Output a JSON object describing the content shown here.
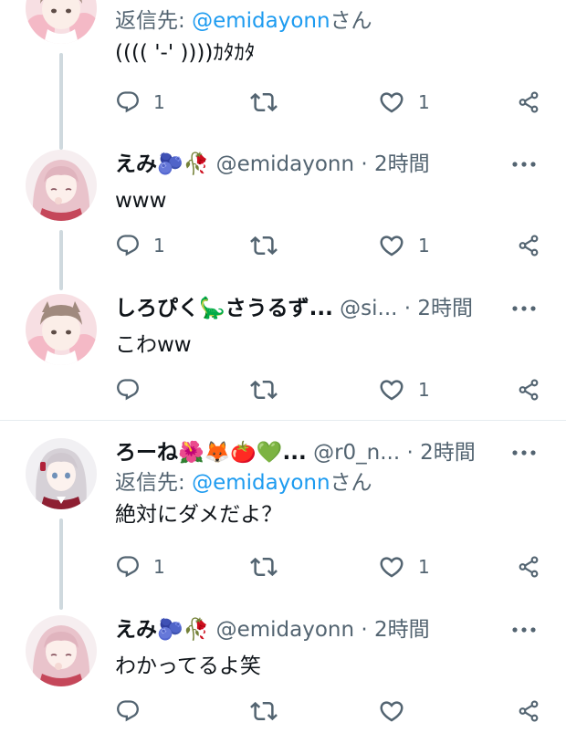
{
  "tweets": [
    {
      "name": "",
      "handle": "",
      "time": "",
      "reply_prefix": "返信先: ",
      "reply_mention": "@emidayonn",
      "reply_suffix": "さん",
      "text": "(((( '-'  ))))ｶﾀｶﾀ",
      "reply_count": "1",
      "like_count": "1",
      "avatar": "avatar-shiropiku"
    },
    {
      "name": "えみ🫐🥀",
      "handle": "@emidayonn",
      "dot": "·",
      "time": "2時間",
      "text": "www",
      "reply_count": "1",
      "like_count": "1",
      "avatar": "avatar-emi"
    },
    {
      "name": "しろぴく🦕さうるず...",
      "handle": "@si...",
      "dot": "·",
      "time": "2時間",
      "text": "こわww",
      "reply_count": "",
      "like_count": "1",
      "avatar": "avatar-shiropiku"
    },
    {
      "name": "ろーね🌺🦊🍅💚...",
      "handle": "@r0_n...",
      "dot": "·",
      "time": "2時間",
      "reply_prefix": "返信先: ",
      "reply_mention": "@emidayonn",
      "reply_suffix": "さん",
      "text": "絶対にダメだよ？",
      "reply_count": "1",
      "like_count": "1",
      "avatar": "avatar-rone"
    },
    {
      "name": "えみ🫐🥀",
      "handle": "@emidayonn",
      "dot": "·",
      "time": "2時間",
      "text": "わかってるよ笑",
      "reply_count": "",
      "like_count": "",
      "avatar": "avatar-emi"
    }
  ],
  "icons": {
    "reply": "reply-icon",
    "retweet": "retweet-icon",
    "like": "heart-icon",
    "share": "share-icon",
    "more": "more-icon"
  },
  "colors": {
    "mention": "#1d9bf0",
    "secondary_text": "#536471",
    "thread_line": "#cfd9de"
  }
}
